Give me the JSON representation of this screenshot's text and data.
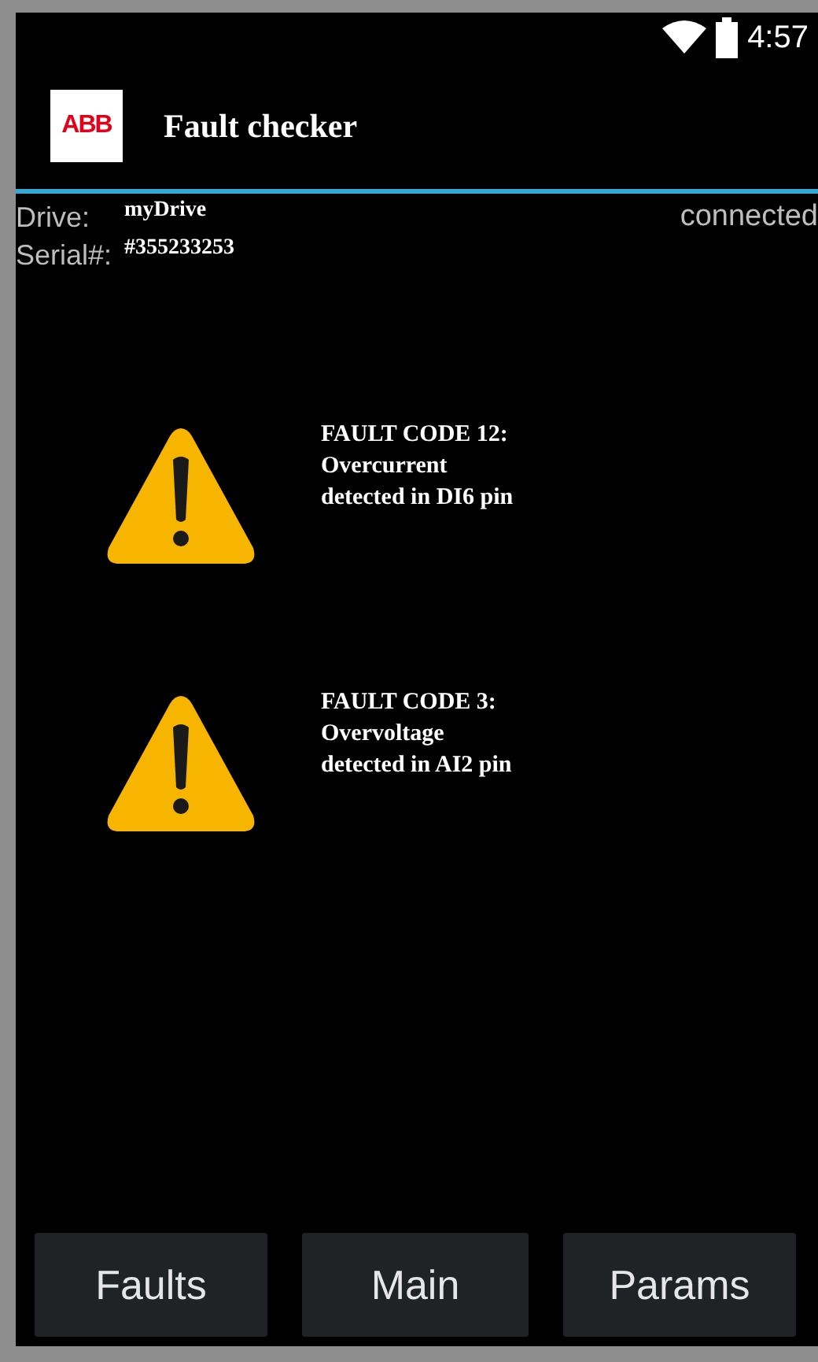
{
  "status_bar": {
    "time": "4:57"
  },
  "app_bar": {
    "logo": "ABB",
    "title": "Fault checker"
  },
  "drive": {
    "drive_label": "Drive:",
    "drive_name": "myDrive",
    "serial_label": "Serial#:",
    "serial": "#355233253",
    "connection": "connected"
  },
  "faults": [
    {
      "code": "FAULT CODE 12:",
      "lines": [
        "Overcurrent",
        "detected in DI6 pin"
      ]
    },
    {
      "code": "FAULT CODE 3:",
      "lines": [
        "Overvoltage",
        "detected in AI2 pin"
      ]
    }
  ],
  "buttons": [
    "Faults",
    "Main",
    "Params"
  ]
}
